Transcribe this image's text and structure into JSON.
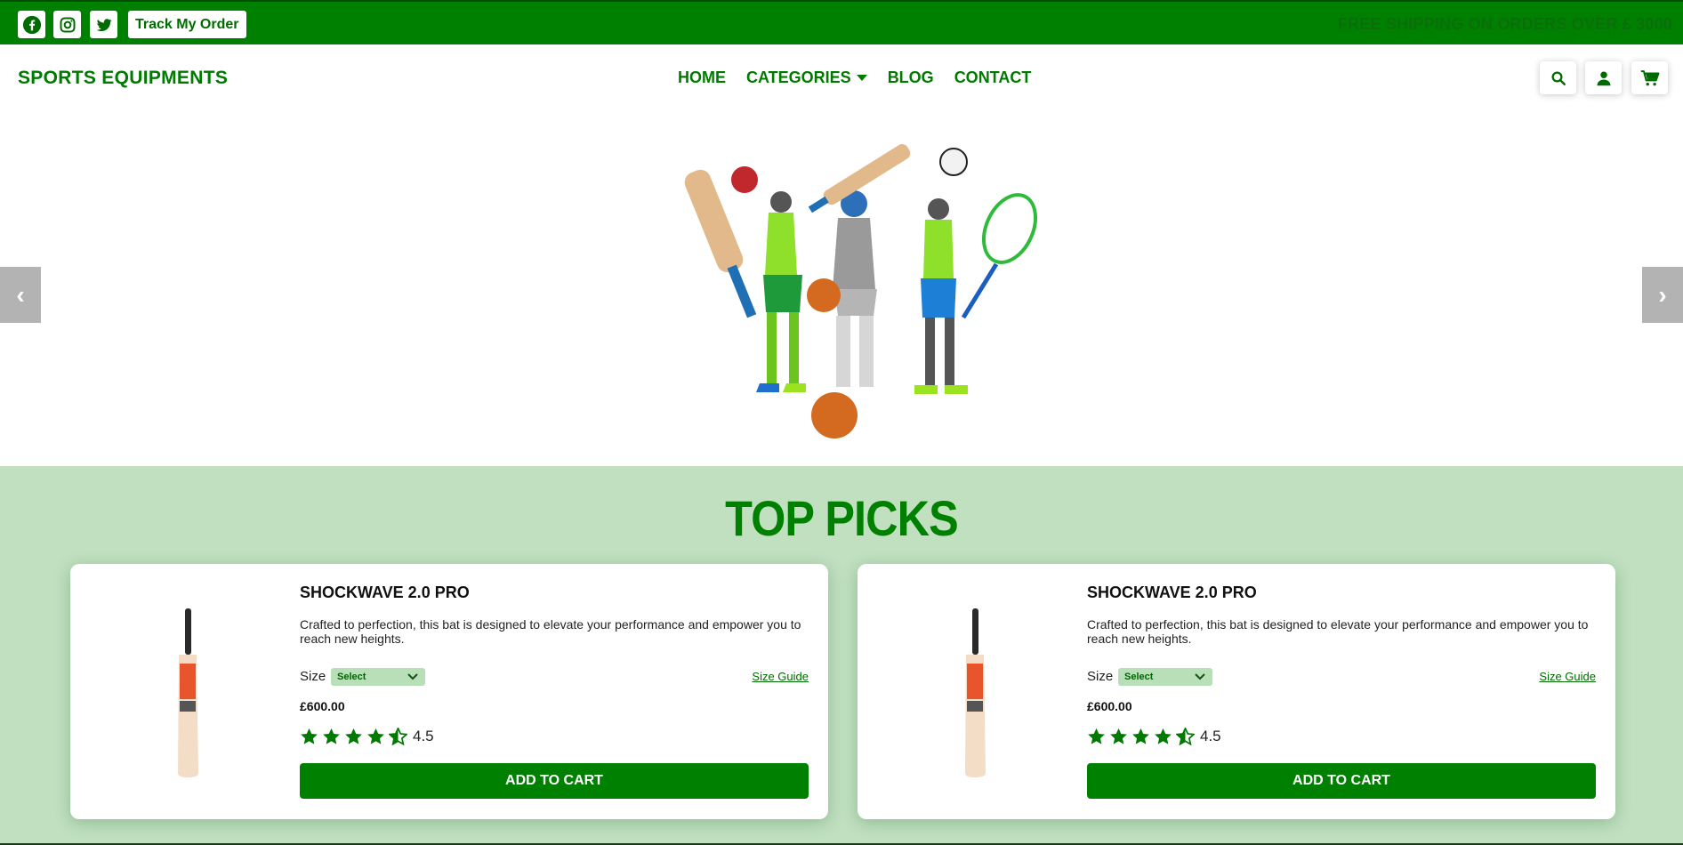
{
  "topbar": {
    "social": [
      "facebook-icon",
      "instagram-icon",
      "twitter-icon"
    ],
    "track_label": "Track My Order",
    "shipping_text": "FREE SHIPPING ON ORDERS OVER £ 3000"
  },
  "header": {
    "logo": "SPORTS EQUIPMENTS",
    "nav": [
      "HOME",
      "CATEGORIES",
      "BLOG",
      "CONTACT"
    ],
    "icons": [
      "search-icon",
      "user-icon",
      "cart-icon"
    ]
  },
  "hero": {
    "prev": "‹",
    "next": "›"
  },
  "picks": {
    "title": "TOP PICKS",
    "products": [
      {
        "title": "SHOCKWAVE 2.0 PRO",
        "description": "Crafted to perfection, this bat is designed to elevate your performance and empower you to reach new heights.",
        "size_label": "Size",
        "size_value": "Select",
        "size_guide": "Size Guide",
        "price": "£600.00",
        "rating": 4.5,
        "rating_text": "4.5",
        "button": "ADD TO CART"
      },
      {
        "title": "SHOCKWAVE 2.0 PRO",
        "description": "Crafted to perfection, this bat is designed to elevate your performance and empower you to reach new heights.",
        "size_label": "Size",
        "size_value": "Select",
        "size_guide": "Size Guide",
        "price": "£600.00",
        "rating": 4.5,
        "rating_text": "4.5",
        "button": "ADD TO CART"
      }
    ]
  },
  "colors": {
    "brand_green": "#008000",
    "picks_bg": "#c0e0c0"
  }
}
